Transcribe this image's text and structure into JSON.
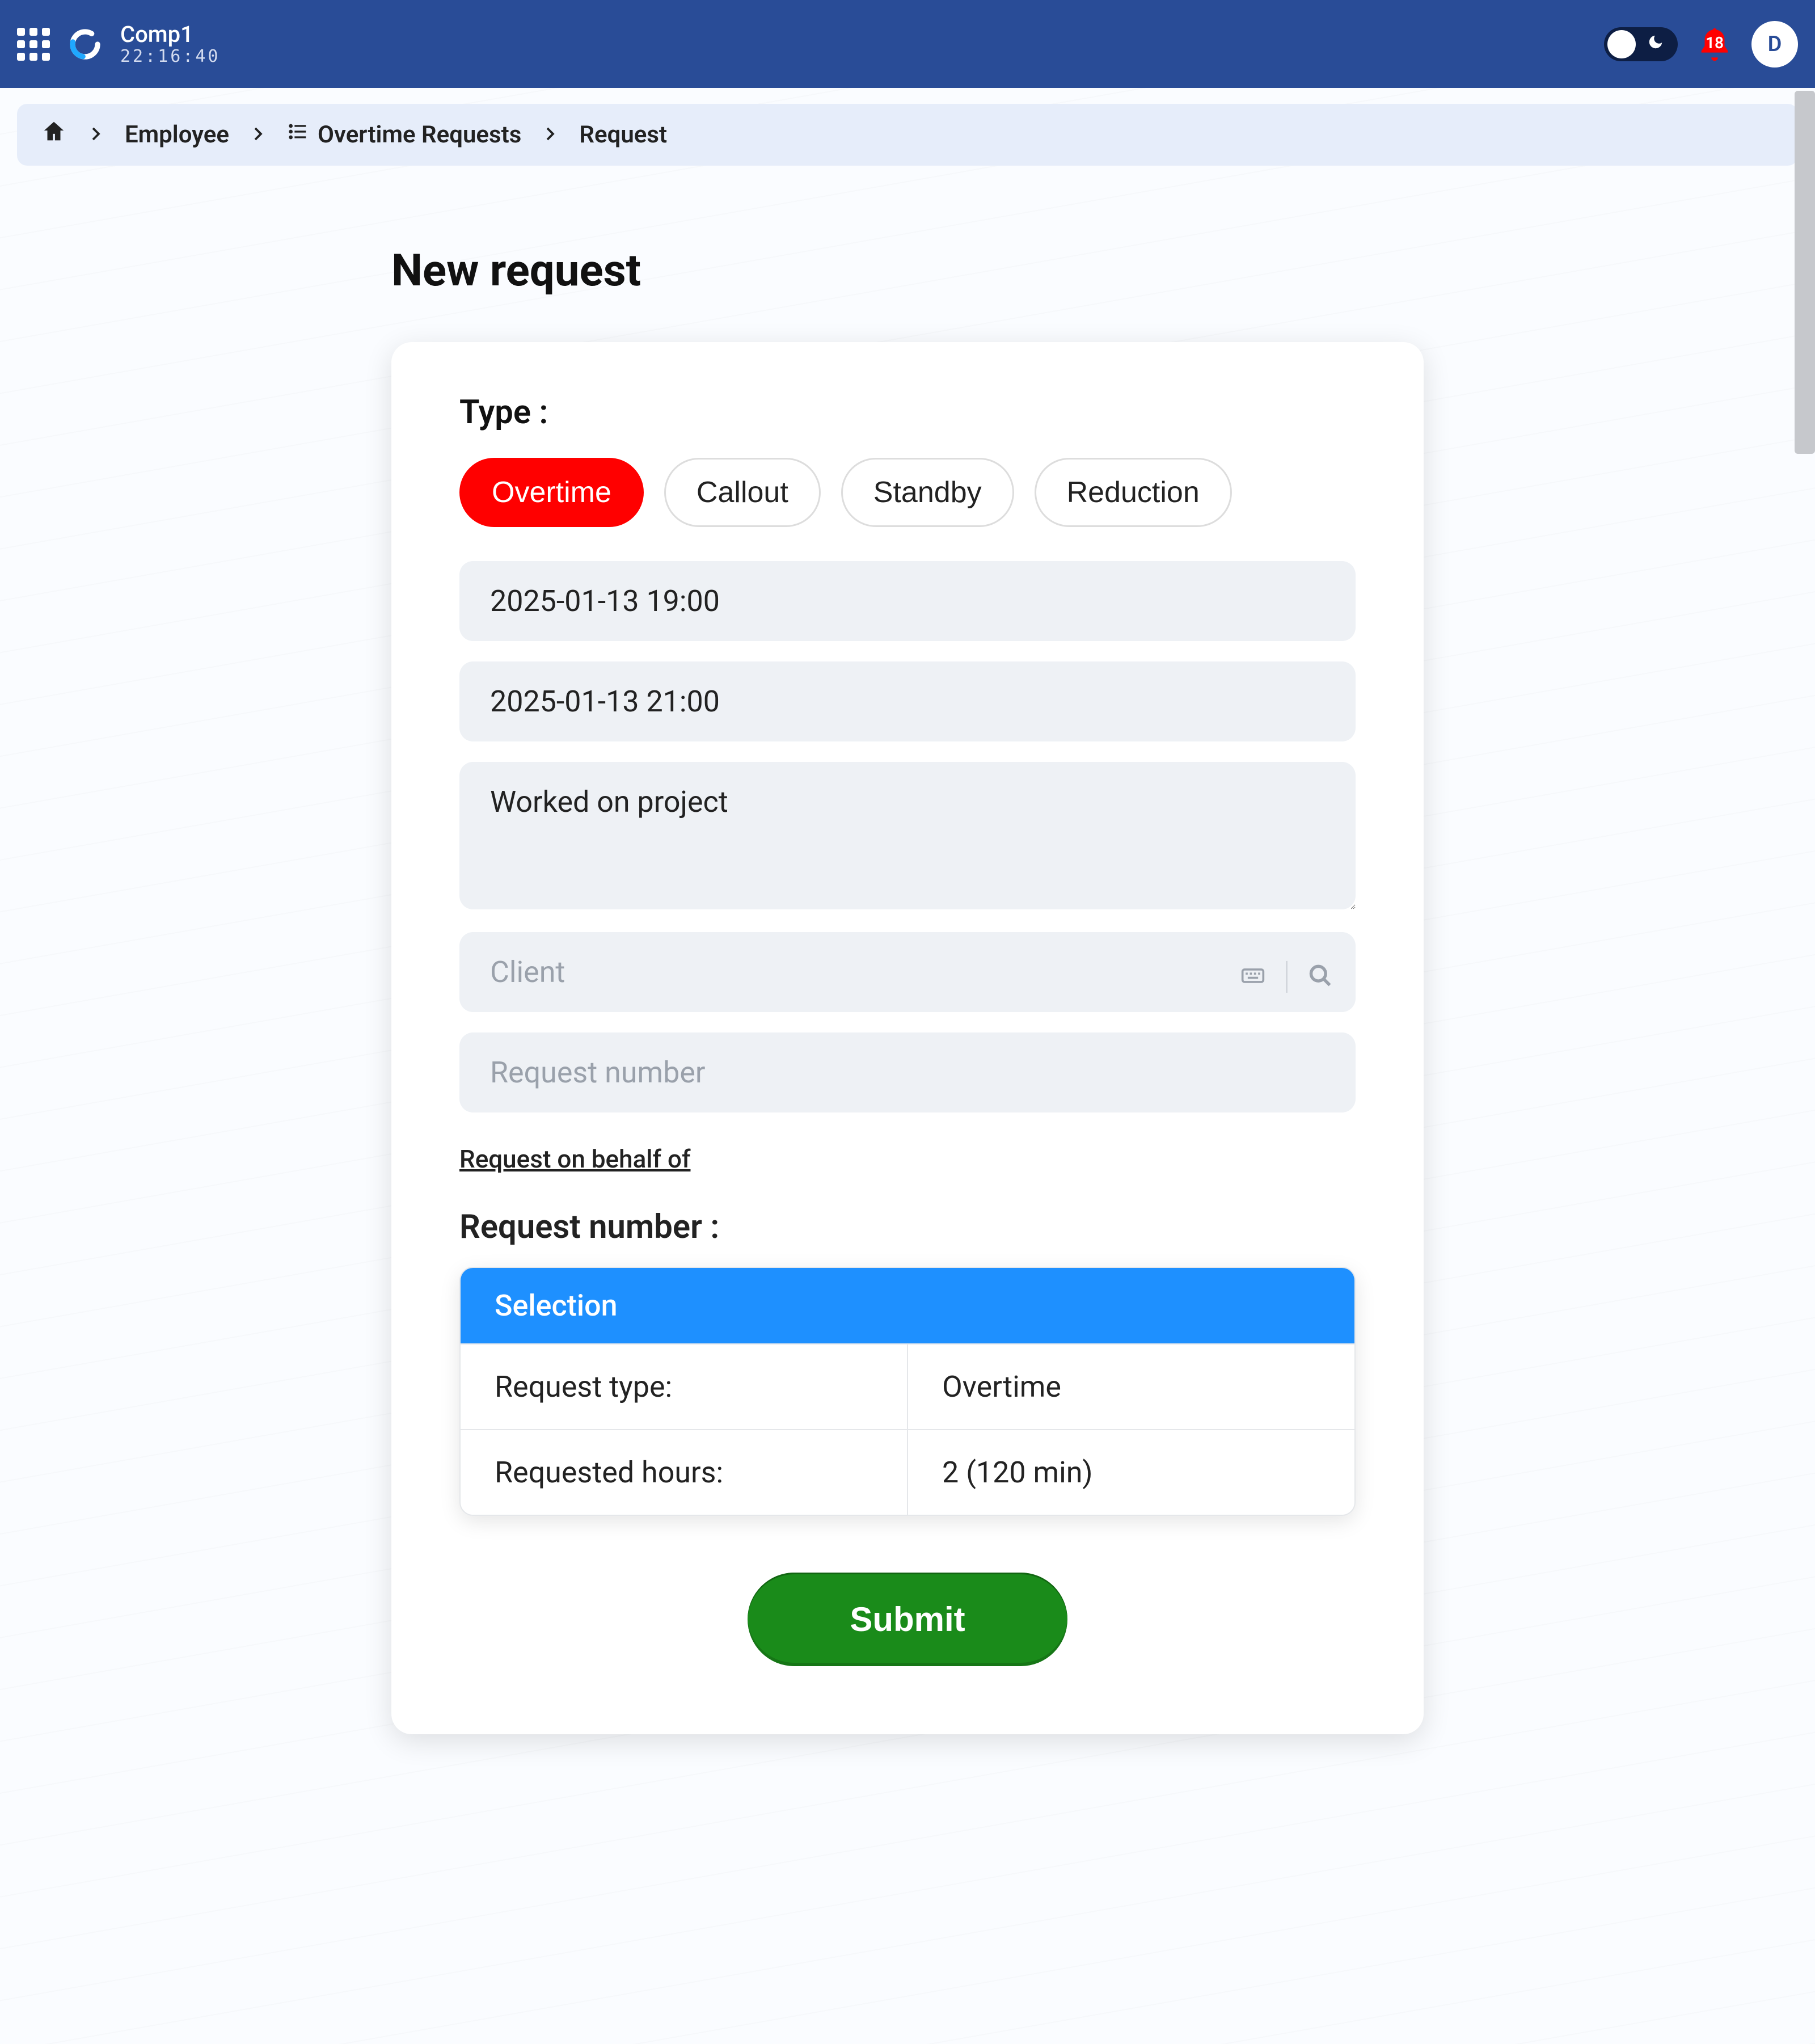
{
  "nav": {
    "company_name": "Comp1",
    "time": "22:16:40",
    "notifications_count": "18",
    "avatar_letter": "D"
  },
  "breadcrumb": {
    "home_aria": "Home",
    "items": [
      "Employee",
      "Overtime Requests",
      "Request"
    ]
  },
  "page": {
    "title": "New request"
  },
  "form": {
    "type_label": "Type :",
    "types": [
      "Overtime",
      "Callout",
      "Standby",
      "Reduction"
    ],
    "type_selected": "Overtime",
    "start_value": "2025-01-13 19:00",
    "end_value": "2025-01-13 21:00",
    "description_value": "Worked on project",
    "client_placeholder": "Client",
    "request_number_placeholder": "Request number",
    "behalf_link": "Request on behalf of"
  },
  "summary": {
    "label": "Request number :",
    "header": "Selection",
    "rows": [
      {
        "k": "Request type:",
        "v": "Overtime"
      },
      {
        "k": "Requested hours:",
        "v": "2 (120 min)"
      }
    ]
  },
  "actions": {
    "submit": "Submit"
  }
}
